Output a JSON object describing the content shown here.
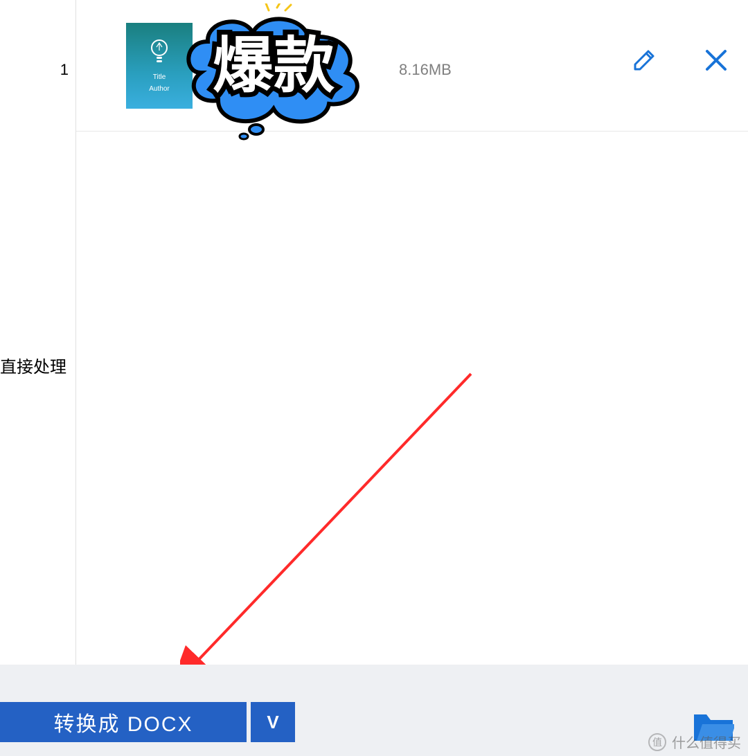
{
  "sidebar": {
    "row_number": "1",
    "partial_text": "直接处理"
  },
  "file": {
    "size": "8.16MB",
    "thumb_line1": "Title",
    "thumb_line2": "Author"
  },
  "sticker_text": "爆款",
  "bottom": {
    "convert_label": "转换成 DOCX",
    "dropdown_glyph": "V"
  },
  "watermark": {
    "badge": "值",
    "text": "什么值得买"
  },
  "colors": {
    "primary": "#2461c4",
    "icon_blue": "#1873d8",
    "arrow": "#ff2a2a"
  }
}
